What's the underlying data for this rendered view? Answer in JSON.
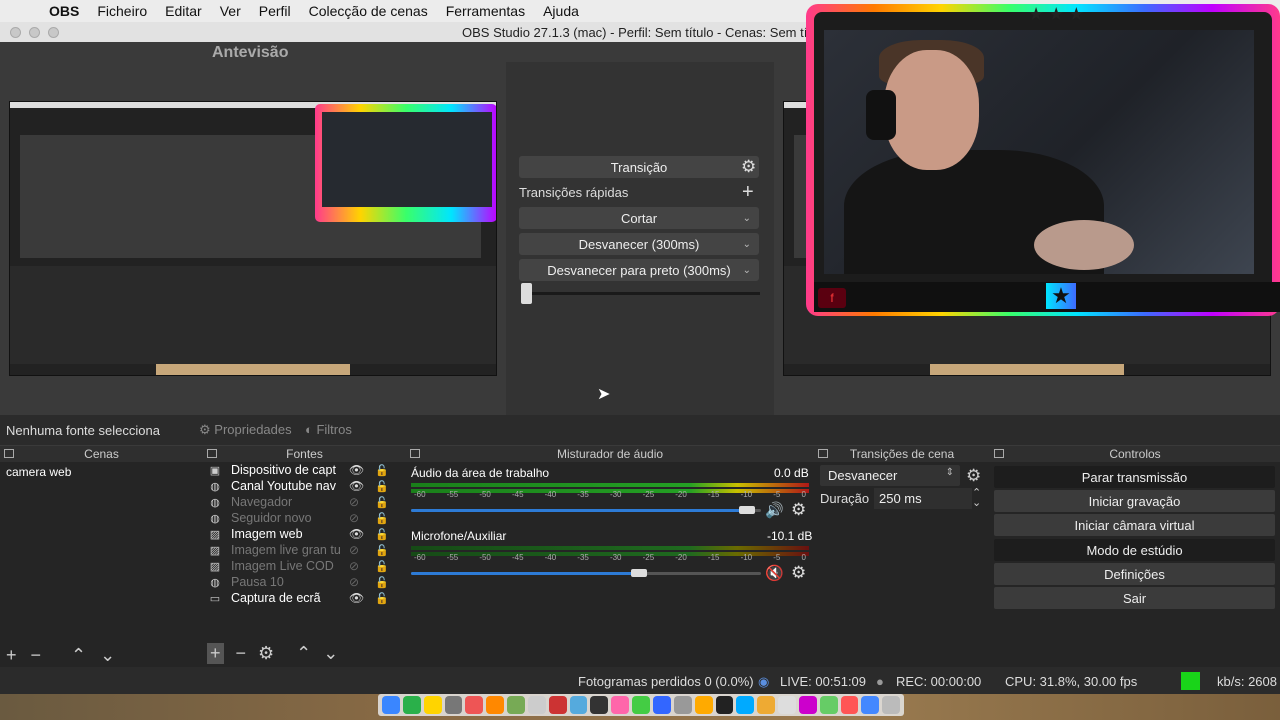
{
  "menubar": {
    "app": "OBS",
    "items": [
      "Ficheiro",
      "Editar",
      "Ver",
      "Perfil",
      "Colecção de cenas",
      "Ferramentas",
      "Ajuda"
    ]
  },
  "window": {
    "title": "OBS Studio 27.1.3 (mac) - Perfil: Sem título - Cenas: Sem tí"
  },
  "preview": {
    "label": "Antevisão"
  },
  "transitions_panel": {
    "transition_label": "Transição",
    "quick_label": "Transições rápidas",
    "items": [
      "Cortar",
      "Desvanecer (300ms)",
      "Desvanecer para preto (300ms)"
    ]
  },
  "source_bar": {
    "no_source": "Nenhuma fonte selecciona",
    "properties": "Propriedades",
    "filters": "Filtros"
  },
  "scenes": {
    "header": "Cenas",
    "items": [
      "camera web"
    ]
  },
  "sources": {
    "header": "Fontes",
    "items": [
      {
        "name": "Dispositivo de capt",
        "visible": true,
        "icon": "camera-icon"
      },
      {
        "name": "Canal Youtube  nav",
        "visible": true,
        "icon": "globe-icon"
      },
      {
        "name": "Navegador",
        "visible": false,
        "icon": "globe-icon"
      },
      {
        "name": "Seguidor novo",
        "visible": false,
        "icon": "globe-icon"
      },
      {
        "name": "Imagem web",
        "visible": true,
        "icon": "image-icon"
      },
      {
        "name": "Imagem live gran tu",
        "visible": false,
        "icon": "image-icon"
      },
      {
        "name": "Imagem Live COD",
        "visible": false,
        "icon": "image-icon"
      },
      {
        "name": "Pausa 10",
        "visible": false,
        "icon": "globe-icon"
      },
      {
        "name": "Captura de ecrã",
        "visible": true,
        "icon": "monitor-icon"
      }
    ]
  },
  "mixer": {
    "header": "Misturador de áudio",
    "ticks": [
      "-60",
      "-55",
      "-50",
      "-45",
      "-40",
      "-35",
      "-30",
      "-25",
      "-20",
      "-15",
      "-10",
      "-5",
      "0"
    ],
    "channels": [
      {
        "name": "Áudio da área de trabalho",
        "db": "0.0 dB",
        "volume": 0.96,
        "muted": false
      },
      {
        "name": "Microfone/Auxiliar",
        "db": "-10.1 dB",
        "volume": 0.65,
        "muted": true
      }
    ]
  },
  "scene_transitions": {
    "header": "Transições de cena",
    "selected": "Desvanecer",
    "duration_label": "Duração",
    "duration_value": "250 ms"
  },
  "controls": {
    "header": "Controlos",
    "buttons": [
      "Parar transmissão",
      "Iniciar gravação",
      "Iniciar câmara virtual",
      "Modo de estúdio",
      "Definições",
      "Sair"
    ]
  },
  "status": {
    "dropped": "Fotogramas perdidos 0 (0.0%)",
    "live": "LIVE: 00:51:09",
    "rec": "REC: 00:00:00",
    "cpu": "CPU: 31.8%, 30.00 fps",
    "kbs": "kb/s: 2608",
    "indicator_color": "#19d419"
  },
  "colors": {
    "accent_blue": "#2d7bd6",
    "mute_red": "#e02020"
  }
}
